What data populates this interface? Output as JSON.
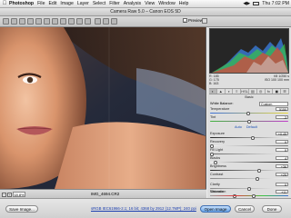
{
  "menubar": {
    "apple": "",
    "app": "Photoshop",
    "items": [
      "File",
      "Edit",
      "Image",
      "Layer",
      "Select",
      "Filter",
      "Analysis",
      "View",
      "Window",
      "Help"
    ],
    "right": [
      "◀▶",
      "Thu 7:02 PM"
    ]
  },
  "window": {
    "title": "Camera Raw 5.0  –  Canon EOS 5D"
  },
  "toolbar": {
    "preview_label": "Preview",
    "preview_checked": "✓"
  },
  "status": {
    "zoom": "18.8%",
    "filename": "IMG_4694.CR2"
  },
  "readout": {
    "r": "R:  185",
    "g": "G:  175",
    "b": "B:  163",
    "f": "f/8   1/250 s",
    "iso": "ISO 100   100 mm"
  },
  "panel": {
    "icons": [
      "◐",
      "▲",
      "◑",
      "≡",
      "HSL",
      "▤",
      "◎",
      "fx",
      "◼",
      "☰"
    ],
    "section": "Basic",
    "wb_label": "White Balance:",
    "wb_value": "Custom",
    "auto": "Auto",
    "default": "Default",
    "sliders": [
      {
        "label": "Temperature",
        "value": "5150"
      },
      {
        "label": "Tint",
        "value": "-3"
      },
      {
        "label": "Exposure",
        "value": "+0.45"
      },
      {
        "label": "Recovery",
        "value": "0"
      },
      {
        "label": "Fill Light",
        "value": "0"
      },
      {
        "label": "Blacks",
        "value": "4"
      },
      {
        "label": "Brightness",
        "value": "+36"
      },
      {
        "label": "Contrast",
        "value": "+25"
      },
      {
        "label": "Clarity",
        "value": "0"
      },
      {
        "label": "Vibrance",
        "value": "-39"
      },
      {
        "label": "Saturation",
        "value": "+11"
      }
    ]
  },
  "bottom": {
    "save": "Save Image...",
    "workflow_link": "sRGB IEC61966-2.1; 16 bit; 4368 by 2912 (12.7MP); 240 ppi",
    "open": "Open Image",
    "cancel": "Cancel",
    "done": "Done"
  }
}
